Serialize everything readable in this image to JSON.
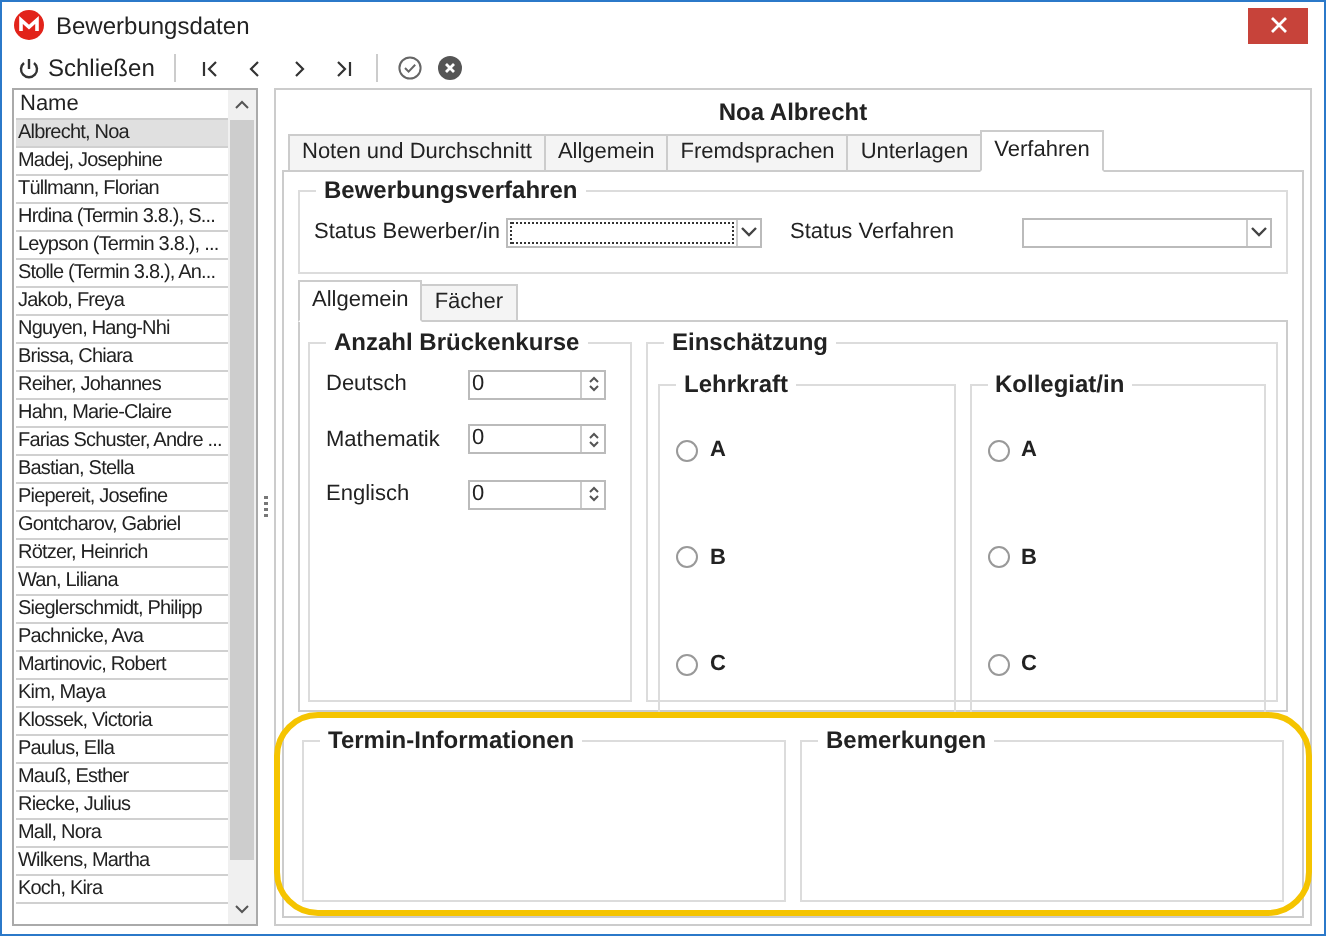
{
  "window": {
    "title": "Bewerbungsdaten"
  },
  "toolbar": {
    "close_label": "Schließen"
  },
  "list": {
    "header": "Name",
    "rows": [
      {
        "name": "Albrecht, Noa",
        "selected": true
      },
      {
        "name": "Madej, Josephine",
        "selected": false
      },
      {
        "name": "Tüllmann, Florian",
        "selected": false
      },
      {
        "name": "Hrdina (Termin 3.8.), S...",
        "selected": false
      },
      {
        "name": "Leypson (Termin 3.8.), ...",
        "selected": false
      },
      {
        "name": "Stolle (Termin 3.8.), An...",
        "selected": false
      },
      {
        "name": "Jakob, Freya",
        "selected": false
      },
      {
        "name": "Nguyen, Hang-Nhi",
        "selected": false
      },
      {
        "name": "Brissa, Chiara",
        "selected": false
      },
      {
        "name": "Reiher, Johannes",
        "selected": false
      },
      {
        "name": "Hahn, Marie-Claire",
        "selected": false
      },
      {
        "name": "Farias Schuster, Andre ...",
        "selected": false
      },
      {
        "name": "Bastian, Stella",
        "selected": false
      },
      {
        "name": "Piepereit, Josefine",
        "selected": false
      },
      {
        "name": "Gontcharov, Gabriel",
        "selected": false
      },
      {
        "name": "Rötzer, Heinrich",
        "selected": false
      },
      {
        "name": "Wan, Liliana",
        "selected": false
      },
      {
        "name": "Sieglerschmidt, Philipp",
        "selected": false
      },
      {
        "name": "Pachnicke, Ava",
        "selected": false
      },
      {
        "name": "Martinovic, Robert",
        "selected": false
      },
      {
        "name": "Kim, Maya",
        "selected": false
      },
      {
        "name": "Klossek, Victoria",
        "selected": false
      },
      {
        "name": "Paulus, Ella",
        "selected": false
      },
      {
        "name": "Mauß, Esther",
        "selected": false
      },
      {
        "name": "Riecke, Julius",
        "selected": false
      },
      {
        "name": "Mall, Nora",
        "selected": false
      },
      {
        "name": "Wilkens, Martha",
        "selected": false
      },
      {
        "name": "Koch, Kira",
        "selected": false
      }
    ]
  },
  "detail": {
    "heading": "Noa Albrecht",
    "tabs": [
      {
        "label": "Noten und Durchschnitt",
        "selected": false
      },
      {
        "label": "Allgemein",
        "selected": false
      },
      {
        "label": "Fremdsprachen",
        "selected": false
      },
      {
        "label": "Unterlagen",
        "selected": false
      },
      {
        "label": "Verfahren",
        "selected": true
      }
    ],
    "procedure": {
      "title": "Bewerbungsverfahren",
      "fields": [
        {
          "label": "Status Bewerber/in",
          "focused": true
        },
        {
          "label": "Status Verfahren",
          "focused": false
        }
      ]
    },
    "subtabs": [
      {
        "label": "Allgemein",
        "selected": true
      },
      {
        "label": "Fächer",
        "selected": false
      }
    ],
    "courses": {
      "title": "Anzahl Brückenkurse",
      "rows": [
        {
          "label": "Deutsch",
          "value": "0"
        },
        {
          "label": "Mathematik",
          "value": "0"
        },
        {
          "label": "Englisch",
          "value": "0"
        }
      ]
    },
    "assessment": {
      "title": "Einschätzung",
      "groups": [
        {
          "title": "Lehrkraft",
          "options": [
            {
              "label": "A",
              "selected": false
            },
            {
              "label": "B",
              "selected": false
            },
            {
              "label": "C",
              "selected": false
            }
          ]
        },
        {
          "title": "Kollegiat/in",
          "options": [
            {
              "label": "A",
              "selected": false
            },
            {
              "label": "B",
              "selected": false
            },
            {
              "label": "C",
              "selected": false
            }
          ]
        }
      ]
    },
    "bottom": {
      "highlighted": true,
      "boxes": [
        {
          "title": "Termin-Informationen"
        },
        {
          "title": "Bemerkungen"
        }
      ]
    }
  }
}
